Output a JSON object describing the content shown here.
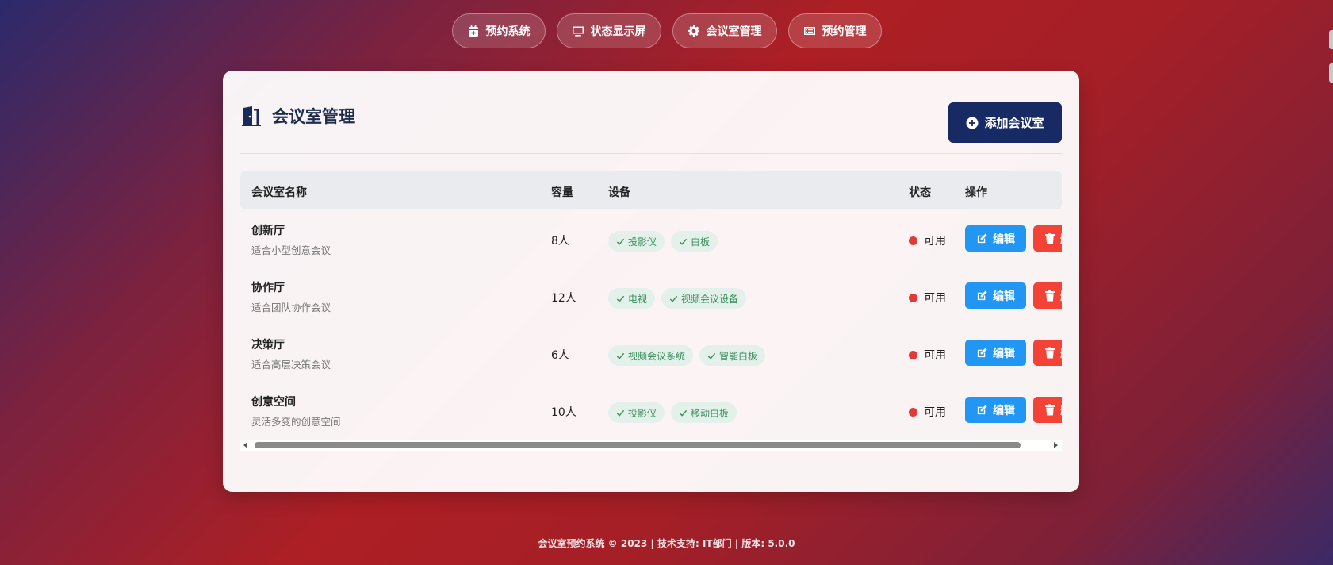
{
  "nav": [
    {
      "label": "预约系统",
      "icon": "calendar-plus-icon"
    },
    {
      "label": "状态显示屏",
      "icon": "monitor-icon"
    },
    {
      "label": "会议室管理",
      "icon": "gear-icon"
    },
    {
      "label": "预约管理",
      "icon": "list-icon"
    }
  ],
  "page": {
    "title": "会议室管理",
    "add_button": "添加会议室"
  },
  "table": {
    "headers": [
      "会议室名称",
      "容量",
      "设备",
      "状态",
      "操作"
    ],
    "rows": [
      {
        "name": "创新厅",
        "desc": "适合小型创意会议",
        "capacity": "8人",
        "equipment": [
          "投影仪",
          "白板"
        ],
        "status": "可用"
      },
      {
        "name": "协作厅",
        "desc": "适合团队协作会议",
        "capacity": "12人",
        "equipment": [
          "电视",
          "视频会议设备"
        ],
        "status": "可用"
      },
      {
        "name": "决策厅",
        "desc": "适合高层决策会议",
        "capacity": "6人",
        "equipment": [
          "视频会议系统",
          "智能白板"
        ],
        "status": "可用"
      },
      {
        "name": "创意空间",
        "desc": "灵活多变的创意空间",
        "capacity": "10人",
        "equipment": [
          "投影仪",
          "移动白板"
        ],
        "status": "可用"
      }
    ],
    "edit_label": "编辑",
    "delete_label": "删"
  },
  "footer": "会议室预约系统 © 2023 | 技术支持: IT部门 | 版本: 5.0.0",
  "colors": {
    "primary": "#172a63",
    "edit": "#2196f3",
    "delete": "#f44336",
    "status_dot": "#e03a3a",
    "tag_bg": "#e4f1ea",
    "tag_text": "#3a8f5c"
  }
}
